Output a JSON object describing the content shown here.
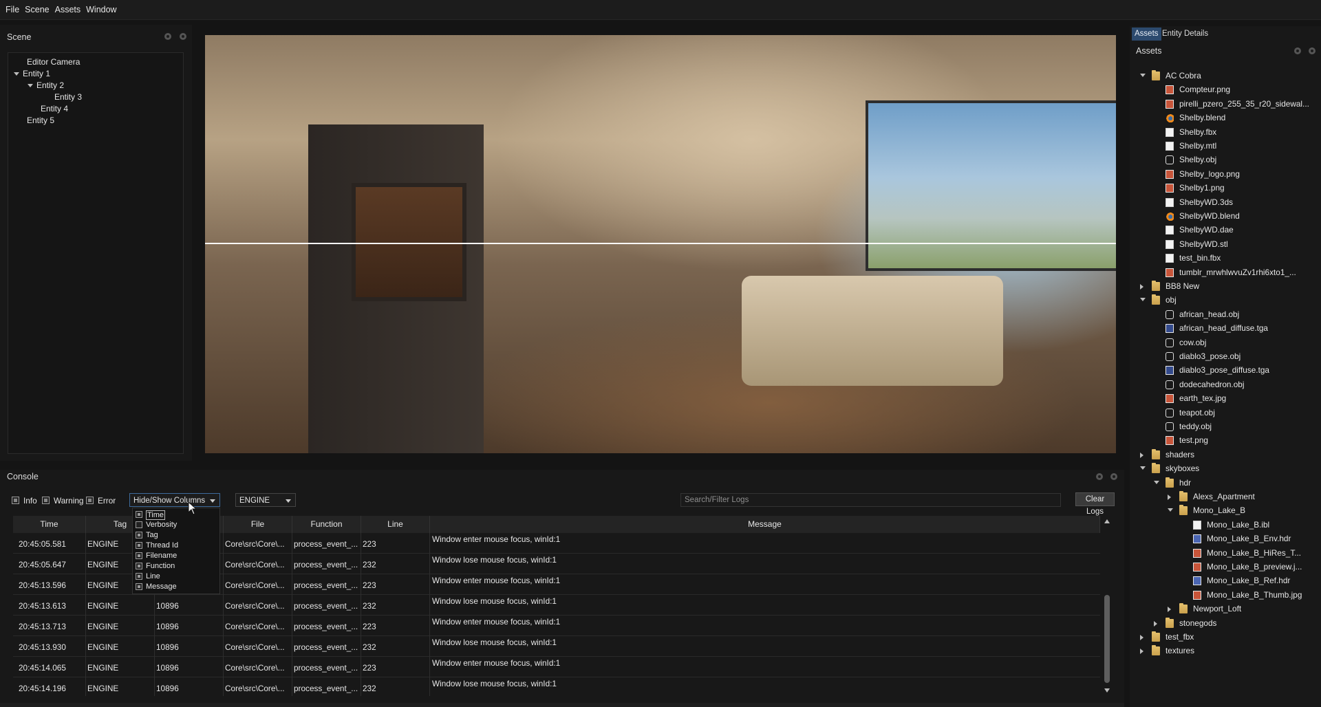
{
  "menu": [
    "File",
    "Scene",
    "Assets",
    "Window"
  ],
  "scene": {
    "title": "Scene",
    "items": [
      {
        "label": "Editor Camera"
      },
      {
        "label": "Entity 1"
      },
      {
        "label": "Entity 2"
      },
      {
        "label": "Entity 3"
      },
      {
        "label": "Entity 4"
      },
      {
        "label": "Entity 5"
      }
    ]
  },
  "assets": {
    "tabs": [
      "Assets",
      "Entity Details"
    ],
    "title": "Assets",
    "tree": [
      {
        "label": "AC Cobra",
        "icon": "folder-icon"
      },
      {
        "label": "Compteur.png",
        "icon": "image-icon"
      },
      {
        "label": "pirelli_pzero_255_35_r20_sidewal...",
        "icon": "image-icon"
      },
      {
        "label": "Shelby.blend",
        "icon": "blender-icon"
      },
      {
        "label": "Shelby.fbx",
        "icon": "file-icon"
      },
      {
        "label": "Shelby.mtl",
        "icon": "file-icon"
      },
      {
        "label": "Shelby.obj",
        "icon": "mesh-icon"
      },
      {
        "label": "Shelby_logo.png",
        "icon": "image-icon"
      },
      {
        "label": "Shelby1.png",
        "icon": "image-icon"
      },
      {
        "label": "ShelbyWD.3ds",
        "icon": "file-icon"
      },
      {
        "label": "ShelbyWD.blend",
        "icon": "blender-icon"
      },
      {
        "label": "ShelbyWD.dae",
        "icon": "file-icon"
      },
      {
        "label": "ShelbyWD.stl",
        "icon": "file-icon"
      },
      {
        "label": "test_bin.fbx",
        "icon": "file-icon"
      },
      {
        "label": "tumblr_mrwhlwvuZv1rhi6xto1_...",
        "icon": "image-icon"
      },
      {
        "label": "BB8 New",
        "icon": "folder-icon"
      },
      {
        "label": "obj",
        "icon": "folder-icon"
      },
      {
        "label": "african_head.obj",
        "icon": "mesh-icon"
      },
      {
        "label": "african_head_diffuse.tga",
        "icon": "texture-icon"
      },
      {
        "label": "cow.obj",
        "icon": "mesh-icon"
      },
      {
        "label": "diablo3_pose.obj",
        "icon": "mesh-icon"
      },
      {
        "label": "diablo3_pose_diffuse.tga",
        "icon": "texture-icon"
      },
      {
        "label": "dodecahedron.obj",
        "icon": "mesh-icon"
      },
      {
        "label": "earth_tex.jpg",
        "icon": "image-icon"
      },
      {
        "label": "teapot.obj",
        "icon": "mesh-icon"
      },
      {
        "label": "teddy.obj",
        "icon": "mesh-icon"
      },
      {
        "label": "test.png",
        "icon": "image-icon"
      },
      {
        "label": "shaders",
        "icon": "folder-icon"
      },
      {
        "label": "skyboxes",
        "icon": "folder-icon"
      },
      {
        "label": "hdr",
        "icon": "folder-icon"
      },
      {
        "label": "Alexs_Apartment",
        "icon": "folder-icon"
      },
      {
        "label": "Mono_Lake_B",
        "icon": "folder-icon"
      },
      {
        "label": "Mono_Lake_B.ibl",
        "icon": "file-icon"
      },
      {
        "label": "Mono_Lake_B_Env.hdr",
        "icon": "hdr-icon"
      },
      {
        "label": "Mono_Lake_B_HiRes_T...",
        "icon": "image-icon"
      },
      {
        "label": "Mono_Lake_B_preview.j...",
        "icon": "image-icon"
      },
      {
        "label": "Mono_Lake_B_Ref.hdr",
        "icon": "hdr-icon"
      },
      {
        "label": "Mono_Lake_B_Thumb.jpg",
        "icon": "image-icon"
      },
      {
        "label": "Newport_Loft",
        "icon": "folder-icon"
      },
      {
        "label": "stonegods",
        "icon": "folder-icon"
      },
      {
        "label": "test_fbx",
        "icon": "folder-icon"
      },
      {
        "label": "textures",
        "icon": "folder-icon"
      }
    ]
  },
  "console": {
    "title": "Console",
    "filters": [
      {
        "label": "Info",
        "checked": true
      },
      {
        "label": "Warning",
        "checked": true
      },
      {
        "label": "Error",
        "checked": true
      }
    ],
    "columns_dropdown": "Hide/Show Columns",
    "tag_select": "ENGINE",
    "search_placeholder": "Search/Filter Logs",
    "clear_label": "Clear Logs",
    "column_options": [
      {
        "label": "Time",
        "checked": true
      },
      {
        "label": "Verbosity",
        "checked": false
      },
      {
        "label": "Tag",
        "checked": true
      },
      {
        "label": "Thread Id",
        "checked": true
      },
      {
        "label": "Filename",
        "checked": true
      },
      {
        "label": "Function",
        "checked": true
      },
      {
        "label": "Line",
        "checked": true
      },
      {
        "label": "Message",
        "checked": true
      }
    ],
    "headers": [
      "Time",
      "Tag",
      "File",
      "Function",
      "Line",
      "Message"
    ],
    "rows": [
      {
        "time": "20:45:05.581",
        "tag": "ENGINE",
        "thread": "",
        "file": "Core\\src\\Core\\...",
        "func": "process_event_...",
        "line": "223",
        "msg": "Window enter mouse focus, winId:1"
      },
      {
        "time": "20:45:05.647",
        "tag": "ENGINE",
        "thread": "",
        "file": "Core\\src\\Core\\...",
        "func": "process_event_...",
        "line": "232",
        "msg": "Window lose mouse focus, winId:1"
      },
      {
        "time": "20:45:13.596",
        "tag": "ENGINE",
        "thread": "",
        "file": "Core\\src\\Core\\...",
        "func": "process_event_...",
        "line": "223",
        "msg": "Window enter mouse focus, winId:1"
      },
      {
        "time": "20:45:13.613",
        "tag": "ENGINE",
        "thread": "10896",
        "file": "Core\\src\\Core\\...",
        "func": "process_event_...",
        "line": "232",
        "msg": "Window lose mouse focus, winId:1"
      },
      {
        "time": "20:45:13.713",
        "tag": "ENGINE",
        "thread": "10896",
        "file": "Core\\src\\Core\\...",
        "func": "process_event_...",
        "line": "223",
        "msg": "Window enter mouse focus, winId:1"
      },
      {
        "time": "20:45:13.930",
        "tag": "ENGINE",
        "thread": "10896",
        "file": "Core\\src\\Core\\...",
        "func": "process_event_...",
        "line": "232",
        "msg": "Window lose mouse focus, winId:1"
      },
      {
        "time": "20:45:14.065",
        "tag": "ENGINE",
        "thread": "10896",
        "file": "Core\\src\\Core\\...",
        "func": "process_event_...",
        "line": "223",
        "msg": "Window enter mouse focus, winId:1"
      },
      {
        "time": "20:45:14.196",
        "tag": "ENGINE",
        "thread": "10896",
        "file": "Core\\src\\Core\\...",
        "func": "process_event_...",
        "line": "232",
        "msg": "Window lose mouse focus, winId:1"
      }
    ]
  },
  "colors": {
    "accent": "#2c4a6e",
    "background": "#141414",
    "panel": "#181818"
  }
}
